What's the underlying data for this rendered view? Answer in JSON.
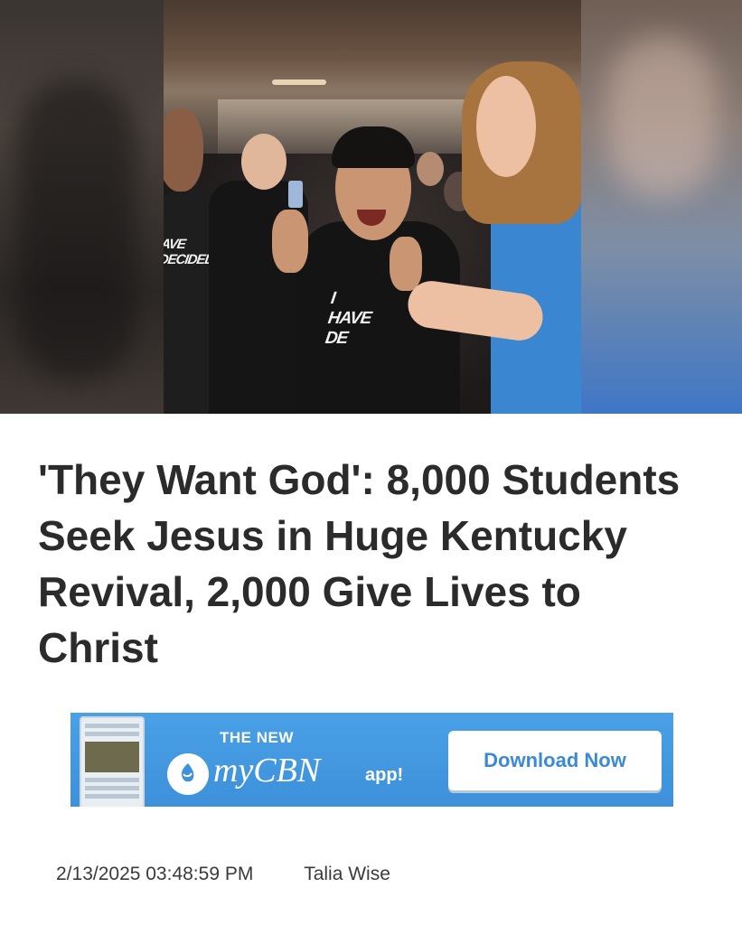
{
  "article": {
    "headline": "'They Want God': 8,000 Students Seek Jesus in Huge Kentucky Revival, 2,000 Give Lives to Christ",
    "date": "2/13/2025 03:48:59 PM",
    "author": "Talia Wise",
    "photo": {
      "shirt_text_left": "AVE DECIDED",
      "shirt_text_center": "I HAVE DE"
    }
  },
  "ad": {
    "kicker": "THE NEW",
    "brand": "myCBN",
    "suffix": "app!",
    "cta": "Download Now",
    "colors": {
      "background": "#3d90da",
      "button_text": "#3a8ad6"
    }
  },
  "colors": {
    "headline": "#2b2b2b",
    "meta": "#3a3a3a"
  }
}
